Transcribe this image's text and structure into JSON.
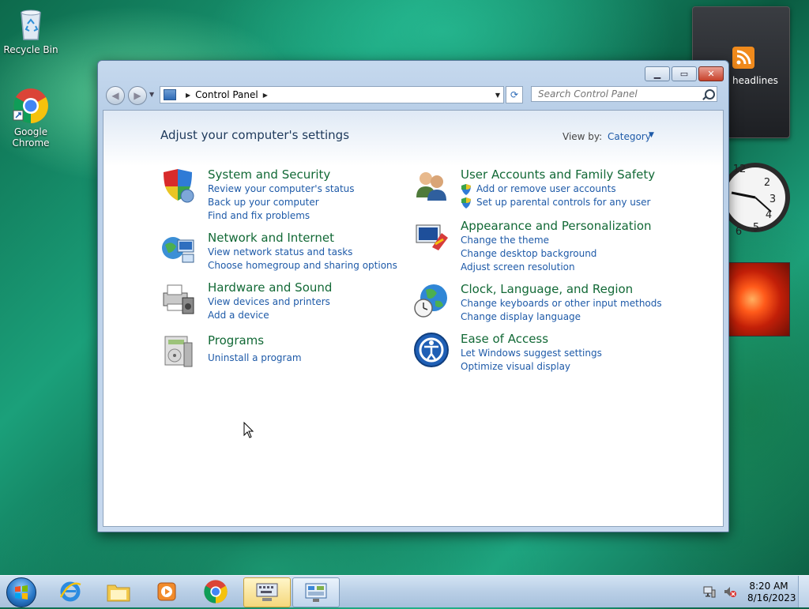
{
  "desktop": {
    "icons": [
      {
        "label": "Recycle Bin",
        "icon": "recycle-bin-icon"
      },
      {
        "label": "Google Chrome",
        "icon": "chrome-icon"
      }
    ],
    "gadgets": {
      "news_label": "headlines",
      "clock_numbers": [
        "12",
        "2",
        "3",
        "4",
        "5",
        "6"
      ]
    }
  },
  "window": {
    "address_crumb": "Control Panel",
    "search_placeholder": "Search Control Panel",
    "heading": "Adjust your computer's settings",
    "view_by_label": "View by:",
    "view_by_value": "Category",
    "categories": [
      {
        "title": "System and Security",
        "icon": "shield-icon",
        "links": [
          "Review your computer's status",
          "Back up your computer",
          "Find and fix problems"
        ]
      },
      {
        "title": "Network and Internet",
        "icon": "network-globe-icon",
        "links": [
          "View network status and tasks",
          "Choose homegroup and sharing options"
        ]
      },
      {
        "title": "Hardware and Sound",
        "icon": "printer-icon",
        "links": [
          "View devices and printers",
          "Add a device"
        ]
      },
      {
        "title": "Programs",
        "icon": "programs-icon",
        "links": [
          "Uninstall a program"
        ]
      },
      {
        "title": "User Accounts and Family Safety",
        "icon": "users-icon",
        "links": [
          "Add or remove user accounts",
          "Set up parental controls for any user"
        ]
      },
      {
        "title": "Appearance and Personalization",
        "icon": "monitor-paint-icon",
        "links": [
          "Change the theme",
          "Change desktop background",
          "Adjust screen resolution"
        ]
      },
      {
        "title": "Clock, Language, and Region",
        "icon": "globe-clock-icon",
        "links": [
          "Change keyboards or other input methods",
          "Change display language"
        ]
      },
      {
        "title": "Ease of Access",
        "icon": "ease-of-access-icon",
        "links": [
          "Let Windows suggest settings",
          "Optimize visual display"
        ]
      }
    ]
  },
  "taskbar": {
    "time": "8:20 AM",
    "date": "8/16/2023",
    "items": [
      {
        "icon": "internet-explorer-icon"
      },
      {
        "icon": "windows-explorer-icon"
      },
      {
        "icon": "media-player-icon"
      },
      {
        "icon": "chrome-icon"
      },
      {
        "icon": "on-screen-keyboard-icon",
        "state": "active"
      },
      {
        "icon": "control-panel-icon",
        "state": "open"
      }
    ]
  }
}
